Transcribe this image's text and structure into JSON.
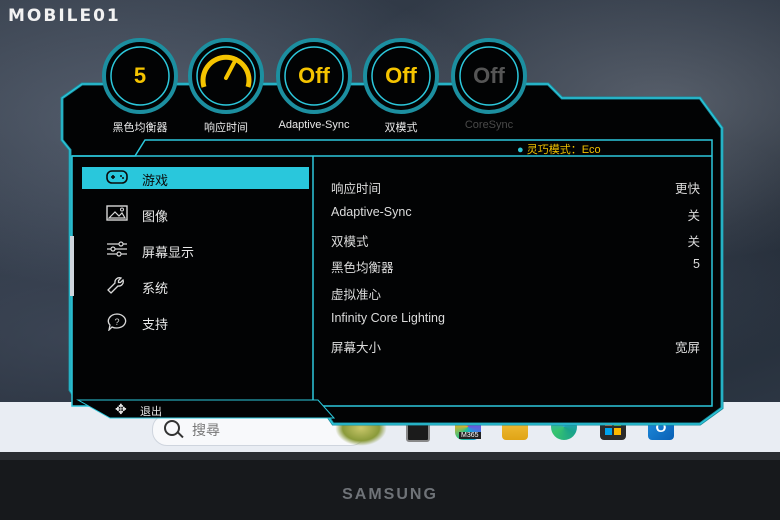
{
  "watermark": "MOBILE01",
  "dials": [
    {
      "value": "5",
      "label": "黑色均衡器",
      "enabled": true
    },
    {
      "value": "",
      "label": "响应时间",
      "enabled": true
    },
    {
      "value": "Off",
      "label": "Adaptive-Sync",
      "enabled": true
    },
    {
      "value": "Off",
      "label": "双模式",
      "enabled": true
    },
    {
      "value": "Off",
      "label": "CoreSync",
      "enabled": false
    }
  ],
  "status": {
    "text": "灵巧模式：Eco"
  },
  "menu": [
    {
      "icon": "gamepad-icon",
      "label": "游戏",
      "active": true
    },
    {
      "icon": "picture-icon",
      "label": "图像",
      "active": false
    },
    {
      "icon": "sliders-icon",
      "label": "屏幕显示",
      "active": false
    },
    {
      "icon": "wrench-icon",
      "label": "系统",
      "active": false
    },
    {
      "icon": "help-icon",
      "label": "支持",
      "active": false
    }
  ],
  "settings": [
    {
      "name": "响应时间",
      "value": "更快"
    },
    {
      "name": "Adaptive-Sync",
      "value": "关"
    },
    {
      "name": "双模式",
      "value": "关"
    },
    {
      "name": "黑色均衡器",
      "value": "5"
    },
    {
      "name": "虚拟准心",
      "value": ""
    },
    {
      "name": "Infinity Core Lighting",
      "value": ""
    },
    {
      "name": "屏幕大小",
      "value": "宽屏"
    }
  ],
  "exit": {
    "label": "退出"
  },
  "taskbar": {
    "search_placeholder": "搜尋",
    "icons": [
      "windows-start-icon",
      "search-icon",
      "widget-icon",
      "task-view-icon",
      "m365-copilot-icon",
      "file-explorer-icon",
      "edge-icon",
      "store-icon",
      "outlook-icon"
    ],
    "m365_label": "M365"
  },
  "monitor_brand": "SAMSUNG",
  "colors": {
    "accent": "#29c7dc",
    "value": "#f5c400",
    "panel": "#020304"
  }
}
